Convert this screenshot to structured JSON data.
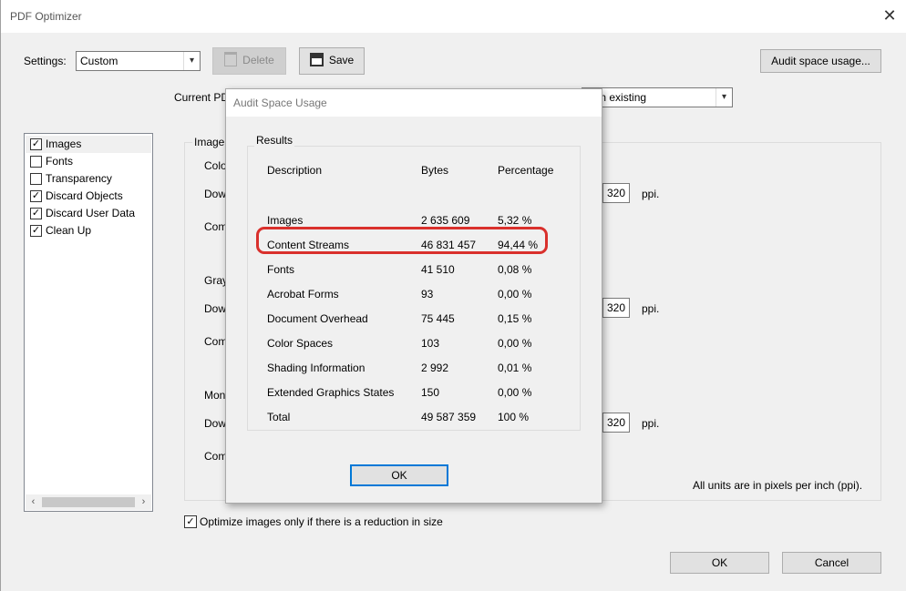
{
  "window": {
    "title": "PDF Optimizer",
    "close_glyph": "✕"
  },
  "toolbar": {
    "settings_label": "Settings:",
    "settings_value": "Custom",
    "delete_label": "Delete",
    "save_label": "Save",
    "audit_button": "Audit space usage...",
    "compat_label": "Current PDF",
    "compat_value": "ain existing"
  },
  "left_panel": {
    "items": [
      {
        "label": "Images",
        "checked": true
      },
      {
        "label": "Fonts",
        "checked": false
      },
      {
        "label": "Transparency",
        "checked": false
      },
      {
        "label": "Discard Objects",
        "checked": true
      },
      {
        "label": "Discard User Data",
        "checked": true
      },
      {
        "label": "Clean Up",
        "checked": true
      }
    ]
  },
  "images_panel": {
    "group_label": "Image S",
    "color": {
      "heading": "Colo",
      "down": "Dow",
      "comp": "Com",
      "ppi": "320"
    },
    "gray": {
      "heading": "Gray",
      "down": "Dow",
      "comp": "Com",
      "ppi": "320"
    },
    "mono": {
      "heading": "Mon",
      "down": "Dow",
      "comp": "Com",
      "ppi": "320"
    },
    "ppi_unit": "ppi.",
    "units_note": "All units are in pixels per inch (ppi).",
    "optimize_checkbox": "Optimize images only if there is a reduction in size"
  },
  "footer": {
    "ok": "OK",
    "cancel": "Cancel"
  },
  "dialog": {
    "title": "Audit Space Usage",
    "results_label": "Results",
    "headers": [
      "Description",
      "Bytes",
      "Percentage"
    ],
    "rows": [
      {
        "desc": "Images",
        "bytes": "2 635 609",
        "pct": "5,32 %"
      },
      {
        "desc": "Content Streams",
        "bytes": "46 831 457",
        "pct": "94,44 %"
      },
      {
        "desc": "Fonts",
        "bytes": "41 510",
        "pct": "0,08 %"
      },
      {
        "desc": "Acrobat Forms",
        "bytes": "93",
        "pct": "0,00 %"
      },
      {
        "desc": "Document Overhead",
        "bytes": "75 445",
        "pct": "0,15 %"
      },
      {
        "desc": "Color Spaces",
        "bytes": "103",
        "pct": "0,00 %"
      },
      {
        "desc": "Shading Information",
        "bytes": "2 992",
        "pct": "0,01 %"
      },
      {
        "desc": "Extended Graphics States",
        "bytes": "150",
        "pct": "0,00 %"
      },
      {
        "desc": "Total",
        "bytes": "49 587 359",
        "pct": "100 %"
      }
    ],
    "ok": "OK",
    "highlight_color": "#d9302c"
  }
}
